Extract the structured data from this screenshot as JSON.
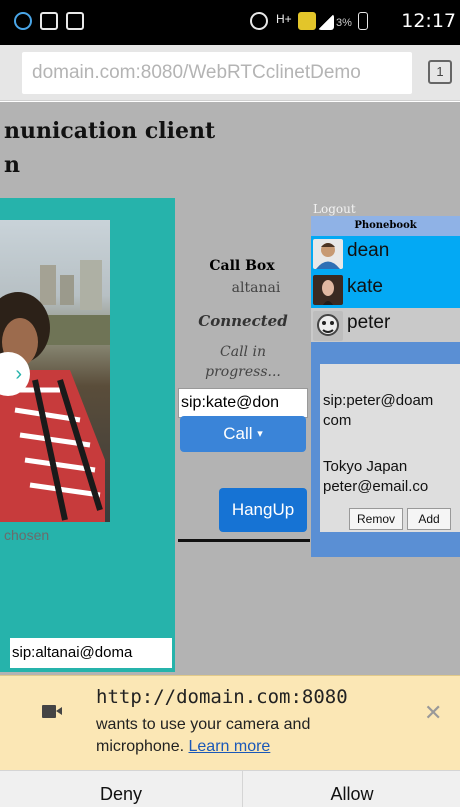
{
  "status_bar": {
    "battery": "3%",
    "time": "12:17"
  },
  "browser": {
    "url": "domain.com:8080/WebRTCclinetDemo",
    "tab_count": "1"
  },
  "page": {
    "title_line1": "nunication client",
    "title_line2": "n",
    "no_file_chosen": "chosen",
    "own_sip": "sip:altanai@doma"
  },
  "call_box": {
    "heading": "Call Box",
    "user": "altanai",
    "status": "Connected",
    "progress_line1": "Call in",
    "progress_line2": "progress...",
    "target_sip": "sip:kate@don",
    "call_label": "Call",
    "hangup_label": "HangUp"
  },
  "phonebook": {
    "logout_label": "Logout",
    "header": "Phonebook",
    "contacts": [
      {
        "name": "dean"
      },
      {
        "name": "kate"
      },
      {
        "name": "peter"
      }
    ],
    "detail": {
      "sip_line1": "sip:peter@doam",
      "sip_line2": "com",
      "location": "Tokyo Japan",
      "email": "peter@email.co"
    },
    "remove_label": "Remov",
    "add_label": "Add"
  },
  "permission": {
    "url": "http://domain.com:8080",
    "message_line1": "wants to use your camera and",
    "message_line2": "microphone.",
    "learn_more": "Learn more",
    "deny_label": "Deny",
    "allow_label": "Allow"
  },
  "colors": {
    "accent_teal": "#26b3ab",
    "button_blue": "#1673d4",
    "infobar": "#fbe7b5",
    "selected_row": "#03a9f4"
  },
  "icons": [
    "camera-icon",
    "close-icon",
    "tab-switcher-icon",
    "alarm-icon",
    "signal-icon",
    "battery-icon"
  ]
}
